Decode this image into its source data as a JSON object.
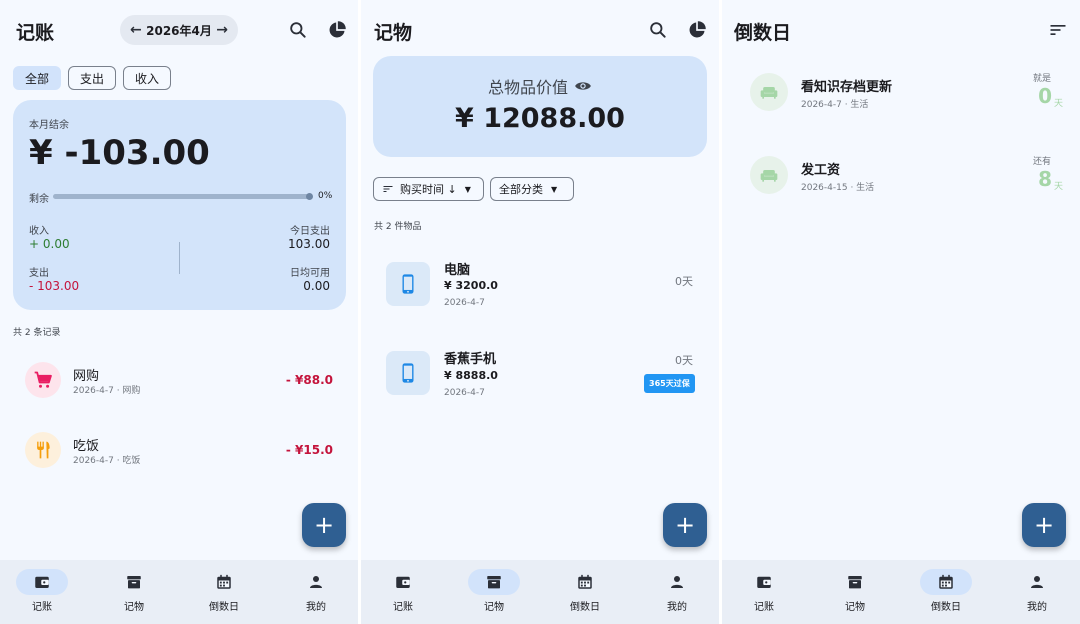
{
  "ledger": {
    "title": "记账",
    "month": "2026年4月",
    "filters": [
      "全部",
      "支出",
      "收入"
    ],
    "summary": {
      "label": "本月结余",
      "balance": "¥ -103.00",
      "remain_label": "剩余",
      "remain_pct_text": "0%",
      "remain_fraction": 0,
      "income_label": "收入",
      "income_value": "+ 0.00",
      "expense_label": "支出",
      "expense_value": "- 103.00",
      "today_label": "今日支出",
      "today_value": "103.00",
      "daily_label": "日均可用",
      "daily_value": "0.00"
    },
    "count_text": "共 2 条记录",
    "records": [
      {
        "name": "网购",
        "meta": "2026-4-7 · 网购",
        "amount": "- ¥88.0",
        "icon": "cart-icon"
      },
      {
        "name": "吃饭",
        "meta": "2026-4-7 · 吃饭",
        "amount": "- ¥15.0",
        "icon": "utensils-icon"
      }
    ]
  },
  "goods": {
    "title": "记物",
    "total_label": "总物品价值",
    "total_value": "¥ 12088.00",
    "sort_label": "购买时间 ↓",
    "category_label": "全部分类",
    "count_text": "共 2 件物品",
    "items": [
      {
        "name": "电脑",
        "price": "¥ 3200.0",
        "date": "2026-4-7",
        "days": "0天",
        "badge": ""
      },
      {
        "name": "香蕉手机",
        "price": "¥ 8888.0",
        "date": "2026-4-7",
        "days": "0天",
        "badge": "365天过保"
      }
    ]
  },
  "countdown": {
    "title": "倒数日",
    "events": [
      {
        "name": "看知识存档更新",
        "meta": "2026-4-7 · 生活",
        "tag": "就是",
        "num": "0",
        "unit": "天"
      },
      {
        "name": "发工资",
        "meta": "2026-4-15 · 生活",
        "tag": "还有",
        "num": "8",
        "unit": "天"
      }
    ]
  },
  "nav": [
    "记账",
    "记物",
    "倒数日",
    "我的"
  ],
  "fab_label": "+",
  "colors": {
    "accent": "#2f5f92",
    "card": "#d3e4fa",
    "negative": "#c4143c",
    "positive": "#2e7d32",
    "countdown_green": "#a5d6a7",
    "badge_blue": "#2196f3"
  }
}
